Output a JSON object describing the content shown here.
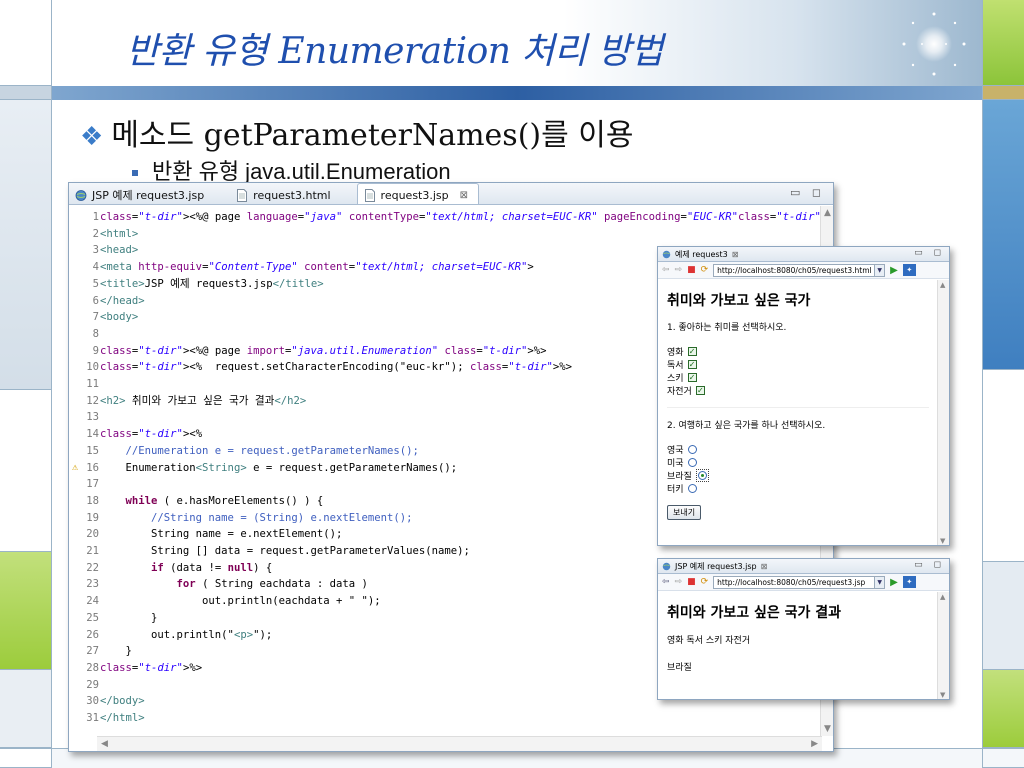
{
  "slide": {
    "title": "반환 유형 Enumeration 처리 방법",
    "bullet_level1": "메소드 getParameterNames()를 이용",
    "bullet_level2": "반환 유형 java.util.Enumeration",
    "colors": {
      "title": "#1f4fae",
      "accent_bar": "#2d5fa3",
      "bullet_diamond": "#3a7cc9",
      "left_grid_green": "#9ccc3c"
    }
  },
  "editor": {
    "tabs": [
      {
        "label": "JSP 예제 request3.jsp",
        "icon": "globe-icon"
      },
      {
        "label": "request3.html",
        "icon": "file-icon"
      },
      {
        "label": "request3.jsp",
        "icon": "file-icon",
        "active": true,
        "close": "⊠"
      }
    ],
    "window_buttons": "▭ ◻",
    "warning_line": 16,
    "lines": [
      {
        "n": "1",
        "code": "<%@ page language=\"java\" contentType=\"text/html; charset=EUC-KR\" pageEncoding=\"EUC-KR\"%>"
      },
      {
        "n": "2",
        "code": "<html>"
      },
      {
        "n": "3",
        "code": "<head>"
      },
      {
        "n": "4",
        "code": "<meta http-equiv=\"Content-Type\" content=\"text/html; charset=EUC-KR\">"
      },
      {
        "n": "5",
        "code": "<title>JSP 예제 request3.jsp</title>"
      },
      {
        "n": "6",
        "code": "</head>"
      },
      {
        "n": "7",
        "code": "<body>"
      },
      {
        "n": "8",
        "code": ""
      },
      {
        "n": "9",
        "code": "<%@ page import=\"java.util.Enumeration\" %>"
      },
      {
        "n": "10",
        "code": "<%  request.setCharacterEncoding(\"euc-kr\"); %>"
      },
      {
        "n": "11",
        "code": ""
      },
      {
        "n": "12",
        "code": "<h2> 취미와 가보고 싶은 국가 결과</h2>"
      },
      {
        "n": "13",
        "code": ""
      },
      {
        "n": "14",
        "code": "<%"
      },
      {
        "n": "15",
        "code": "    //Enumeration e = request.getParameterNames();"
      },
      {
        "n": "16",
        "code": "    Enumeration<String> e = request.getParameterNames();"
      },
      {
        "n": "17",
        "code": ""
      },
      {
        "n": "18",
        "code": "    while ( e.hasMoreElements() ) {"
      },
      {
        "n": "19",
        "code": "        //String name = (String) e.nextElement();"
      },
      {
        "n": "20",
        "code": "        String name = e.nextElement();"
      },
      {
        "n": "21",
        "code": "        String [] data = request.getParameterValues(name);"
      },
      {
        "n": "22",
        "code": "        if (data != null) {"
      },
      {
        "n": "23",
        "code": "            for ( String eachdata : data )"
      },
      {
        "n": "24",
        "code": "                out.println(eachdata + \" \");"
      },
      {
        "n": "25",
        "code": "        }"
      },
      {
        "n": "26",
        "code": "        out.println(\"<p>\");"
      },
      {
        "n": "27",
        "code": "    }"
      },
      {
        "n": "28",
        "code": "%>"
      },
      {
        "n": "29",
        "code": ""
      },
      {
        "n": "30",
        "code": "</body>"
      },
      {
        "n": "31",
        "code": "</html>"
      }
    ]
  },
  "browser1": {
    "tab_label": "예제 request3",
    "tab_close": "⊠",
    "url": "http://localhost:8080/ch05/request3.html",
    "heading": "취미와 가보고 싶은 국가",
    "q1": "1. 좋아하는 취미를 선택하시오.",
    "hobbies": [
      {
        "label": "영화",
        "checked": true
      },
      {
        "label": "독서",
        "checked": true
      },
      {
        "label": "스키",
        "checked": true
      },
      {
        "label": "자전거",
        "checked": true
      }
    ],
    "q2": "2. 여행하고 싶은 국가를 하나 선택하시오.",
    "countries": [
      {
        "label": "영국",
        "selected": false
      },
      {
        "label": "미국",
        "selected": false
      },
      {
        "label": "브라질",
        "selected": true
      },
      {
        "label": "터키",
        "selected": false
      }
    ],
    "submit_label": "보내기"
  },
  "browser2": {
    "tab_label": "JSP 예제 request3.jsp",
    "tab_close": "⊠",
    "url": "http://localhost:8080/ch05/request3.jsp",
    "heading": "취미와 가보고 싶은 국가 결과",
    "result_hobbies": "영화 독서 스키 자전거",
    "result_country": "브라질"
  }
}
